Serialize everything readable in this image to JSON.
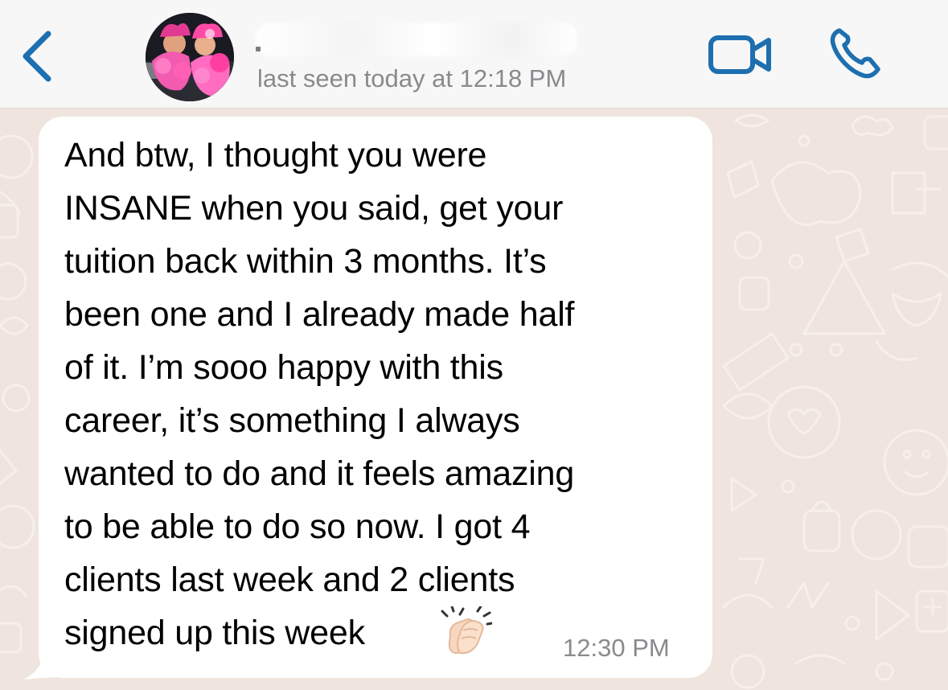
{
  "header": {
    "back_icon": "chevron-left-icon",
    "contact_name": "",
    "status": "last seen today at 12:18 PM",
    "video_icon": "video-camera-icon",
    "call_icon": "phone-icon",
    "accent_color": "#1d6fb0"
  },
  "chat": {
    "wallpaper_color": "#efe5de",
    "message": {
      "text": "And btw, I thought you were\nINSANE when you said, get your\ntuition back within 3 months. It’s\nbeen one and I already made half\nof it. I’m sooo happy with this\ncareer, it’s something I always\nwanted to do and it feels amazing\nto be able to do so now. I got 4\nclients last week and 2 clients\nsigned up this week",
      "emoji": "clapping-hands-icon",
      "time": "12:30 PM",
      "bubble_color": "#ffffff"
    }
  }
}
